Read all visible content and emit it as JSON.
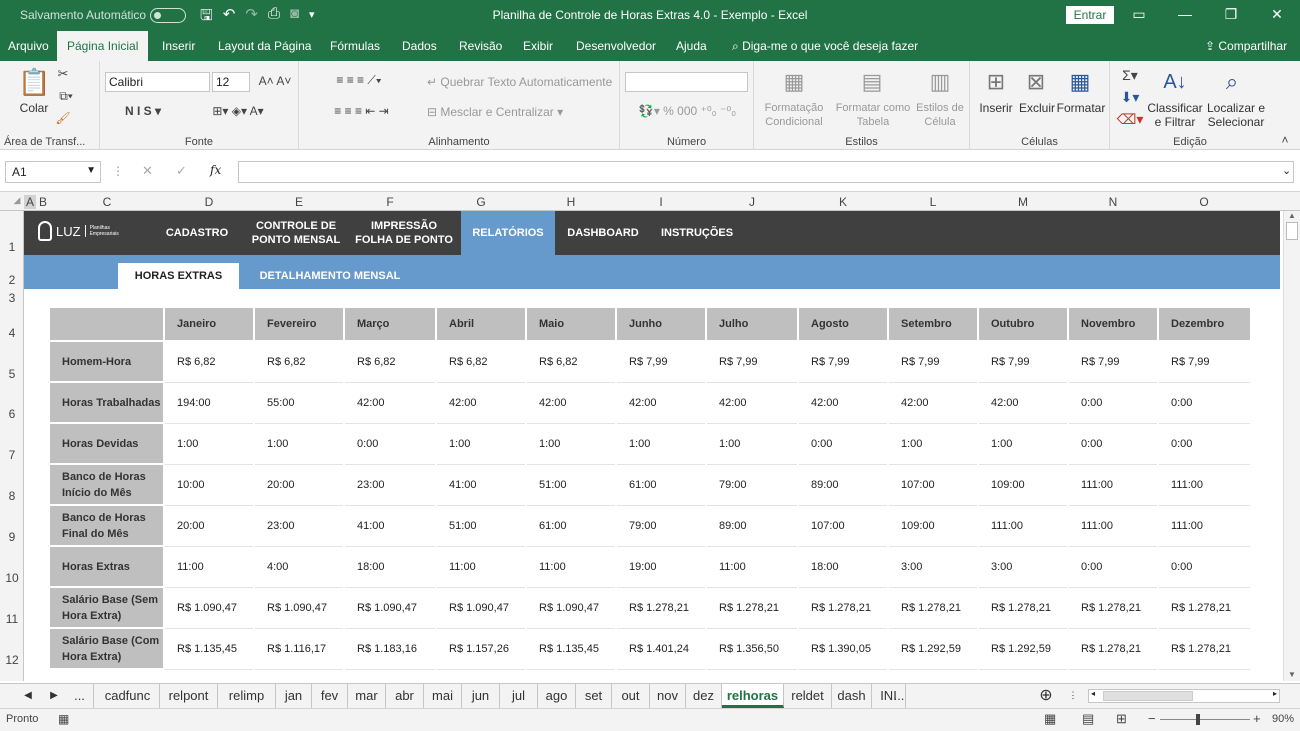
{
  "titlebar": {
    "autosave": "Salvamento Automático",
    "title": "Planilha de Controle de Horas Extras 4.0 - Exemplo  -  Excel",
    "signin": "Entrar"
  },
  "menu": {
    "tabs": [
      "Arquivo",
      "Página Inicial",
      "Inserir",
      "Layout da Página",
      "Fórmulas",
      "Dados",
      "Revisão",
      "Exibir",
      "Desenvolvedor",
      "Ajuda"
    ],
    "tellme": "Diga-me o que você deseja fazer",
    "share": "Compartilhar"
  },
  "ribbon": {
    "clipboard": {
      "paste": "Colar",
      "label": "Área de Transf..."
    },
    "font": {
      "name": "Calibri",
      "size": "12",
      "label": "Fonte"
    },
    "alignment": {
      "wrap": "Quebrar Texto Automaticamente",
      "merge": "Mesclar e Centralizar",
      "label": "Alinhamento"
    },
    "number": {
      "label": "Número"
    },
    "styles": {
      "conditional": "Formatação Condicional",
      "table": "Formatar como Tabela",
      "cell": "Estilos de Célula",
      "label": "Estilos"
    },
    "cells": {
      "insert": "Inserir",
      "delete": "Excluir",
      "format": "Formatar",
      "label": "Células"
    },
    "editing": {
      "sort": "Classificar e Filtrar",
      "find": "Localizar e Selecionar",
      "label": "Edição"
    }
  },
  "formula_bar": {
    "name_box": "A1",
    "fx": "fx",
    "value": ""
  },
  "columns": [
    "A",
    "B",
    "C",
    "D",
    "E",
    "F",
    "G",
    "H",
    "I",
    "J",
    "K",
    "L",
    "M",
    "N",
    "O"
  ],
  "rows": [
    "1",
    "2",
    "3",
    "4",
    "5",
    "6",
    "7",
    "8",
    "9",
    "10",
    "11",
    "12"
  ],
  "app_nav": {
    "logo": "LUZ",
    "logo_sub": "Planilhas Empresariais",
    "items": [
      "CADASTRO",
      "CONTROLE DE PONTO MENSAL",
      "IMPRESSÃO FOLHA DE PONTO",
      "RELATÓRIOS",
      "DASHBOARD",
      "INSTRUÇÕES"
    ],
    "active": "RELATÓRIOS",
    "subtabs": [
      "HORAS EXTRAS",
      "DETALHAMENTO MENSAL"
    ]
  },
  "table": {
    "months": [
      "Janeiro",
      "Fevereiro",
      "Março",
      "Abril",
      "Maio",
      "Junho",
      "Julho",
      "Agosto",
      "Setembro",
      "Outubro",
      "Novembro",
      "Dezembro"
    ],
    "rows": [
      {
        "label": "Homem-Hora",
        "values": [
          "R$ 6,82",
          "R$ 6,82",
          "R$ 6,82",
          "R$ 6,82",
          "R$ 6,82",
          "R$ 7,99",
          "R$ 7,99",
          "R$ 7,99",
          "R$ 7,99",
          "R$ 7,99",
          "R$ 7,99",
          "R$ 7,99"
        ]
      },
      {
        "label": "Horas Trabalhadas",
        "values": [
          "194:00",
          "55:00",
          "42:00",
          "42:00",
          "42:00",
          "42:00",
          "42:00",
          "42:00",
          "42:00",
          "42:00",
          "0:00",
          "0:00"
        ]
      },
      {
        "label": "Horas Devidas",
        "values": [
          "1:00",
          "1:00",
          "0:00",
          "1:00",
          "1:00",
          "1:00",
          "1:00",
          "0:00",
          "1:00",
          "1:00",
          "0:00",
          "0:00"
        ]
      },
      {
        "label": "Banco de Horas Início do Mês",
        "values": [
          "10:00",
          "20:00",
          "23:00",
          "41:00",
          "51:00",
          "61:00",
          "79:00",
          "89:00",
          "107:00",
          "109:00",
          "111:00",
          "111:00"
        ]
      },
      {
        "label": "Banco de Horas Final do Mês",
        "values": [
          "20:00",
          "23:00",
          "41:00",
          "51:00",
          "61:00",
          "79:00",
          "89:00",
          "107:00",
          "109:00",
          "111:00",
          "111:00",
          "111:00"
        ]
      },
      {
        "label": "Horas Extras",
        "values": [
          "11:00",
          "4:00",
          "18:00",
          "11:00",
          "11:00",
          "19:00",
          "11:00",
          "18:00",
          "3:00",
          "3:00",
          "0:00",
          "0:00"
        ]
      },
      {
        "label": "Salário Base (Sem Hora Extra)",
        "values": [
          "R$ 1.090,47",
          "R$ 1.090,47",
          "R$ 1.090,47",
          "R$ 1.090,47",
          "R$ 1.090,47",
          "R$ 1.278,21",
          "R$ 1.278,21",
          "R$ 1.278,21",
          "R$ 1.278,21",
          "R$ 1.278,21",
          "R$ 1.278,21",
          "R$ 1.278,21"
        ]
      },
      {
        "label": "Salário Base (Com Hora Extra)",
        "values": [
          "R$ 1.135,45",
          "R$ 1.116,17",
          "R$ 1.183,16",
          "R$ 1.157,26",
          "R$ 1.135,45",
          "R$ 1.401,24",
          "R$ 1.356,50",
          "R$ 1.390,05",
          "R$ 1.292,59",
          "R$ 1.292,59",
          "R$ 1.278,21",
          "R$ 1.278,21"
        ]
      }
    ]
  },
  "sheets": {
    "tabs": [
      "cadfunc",
      "relpont",
      "relimp",
      "jan",
      "fev",
      "mar",
      "abr",
      "mai",
      "jun",
      "jul",
      "ago",
      "set",
      "out",
      "nov",
      "dez",
      "relhoras",
      "reldet",
      "dash",
      "INI"
    ],
    "active": "relhoras"
  },
  "status": {
    "ready": "Pronto",
    "zoom": "90%"
  },
  "colors": {
    "excel_green": "#217346",
    "nav_dark": "#404040",
    "nav_blue": "#6699cc",
    "header_gray": "#bfbfbf"
  }
}
